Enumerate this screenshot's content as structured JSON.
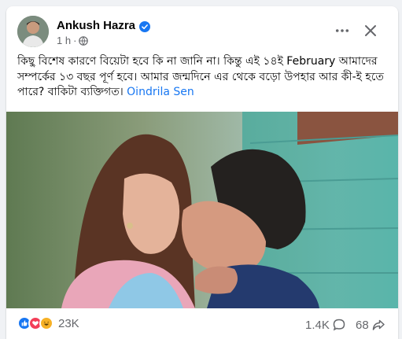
{
  "post": {
    "author": "Ankush Hazra",
    "timestamp": "1 h",
    "dot": "·",
    "text_part1": "কিছু বিশেষ কারণে বিয়েটা হবে কি না জানি না। কিন্তু এই ১৪ই February আমাদের সম্পর্কের ১৩ বছর পূর্ণ হবে। আমার জন্মদিনে এর থেকে বড়ো উপহার আর কী-ই হতে পারে? বাকিটা ব্যক্তিগত।",
    "tag": "Oindrila Sen"
  },
  "icons": {
    "verified": "verified-badge-icon",
    "privacy": "globe-icon",
    "more": "more-options-icon",
    "close": "close-icon",
    "comment": "comment-icon",
    "share": "share-icon"
  },
  "colors": {
    "accent": "#1877f2",
    "like": "#1877f2",
    "love": "#f33e58",
    "haha": "#f7b125",
    "secondary_text": "#65676b"
  },
  "stats": {
    "reactions": "23K",
    "comments": "1.4K",
    "shares": "68"
  }
}
